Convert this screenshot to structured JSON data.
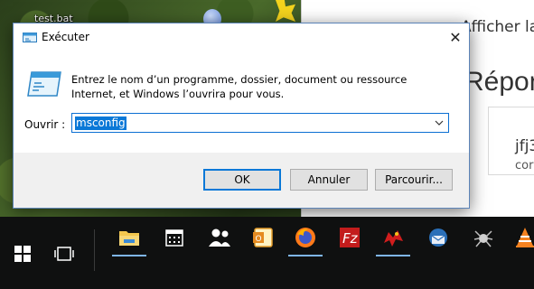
{
  "desktop": {
    "icon_label": "test.bat"
  },
  "browser": {
    "title_fragment": "Afficher la",
    "heading_fragment": "Répon",
    "user_fragment": "jfj3",
    "sub_fragment": "cor"
  },
  "run_dialog": {
    "title": "Exécuter",
    "message": "Entrez le nom d’un programme, dossier, document ou ressource Internet, et Windows l’ouvrira pour vous.",
    "open_label": "Ouvrir :",
    "open_value": "msconfig",
    "buttons": {
      "ok": "OK",
      "cancel": "Annuler",
      "browse": "Parcourir..."
    }
  },
  "taskbar": {
    "items": [
      {
        "name": "start-icon"
      },
      {
        "name": "task-view-icon"
      },
      {
        "name": "file-explorer-icon",
        "active": true
      },
      {
        "name": "calendar-icon"
      },
      {
        "name": "people-icon"
      },
      {
        "name": "outlook-icon"
      },
      {
        "name": "firefox-icon",
        "active": true
      },
      {
        "name": "filezilla-icon"
      },
      {
        "name": "red-app-icon",
        "active": true
      },
      {
        "name": "thunderbird-icon"
      },
      {
        "name": "spider-app-icon"
      },
      {
        "name": "vlc-icon"
      }
    ],
    "accent_color": "#7fb5ea"
  },
  "colors": {
    "selection": "#0a78d7",
    "dialog_border": "#5c84b8",
    "footer_bg": "#f0f0f0"
  }
}
